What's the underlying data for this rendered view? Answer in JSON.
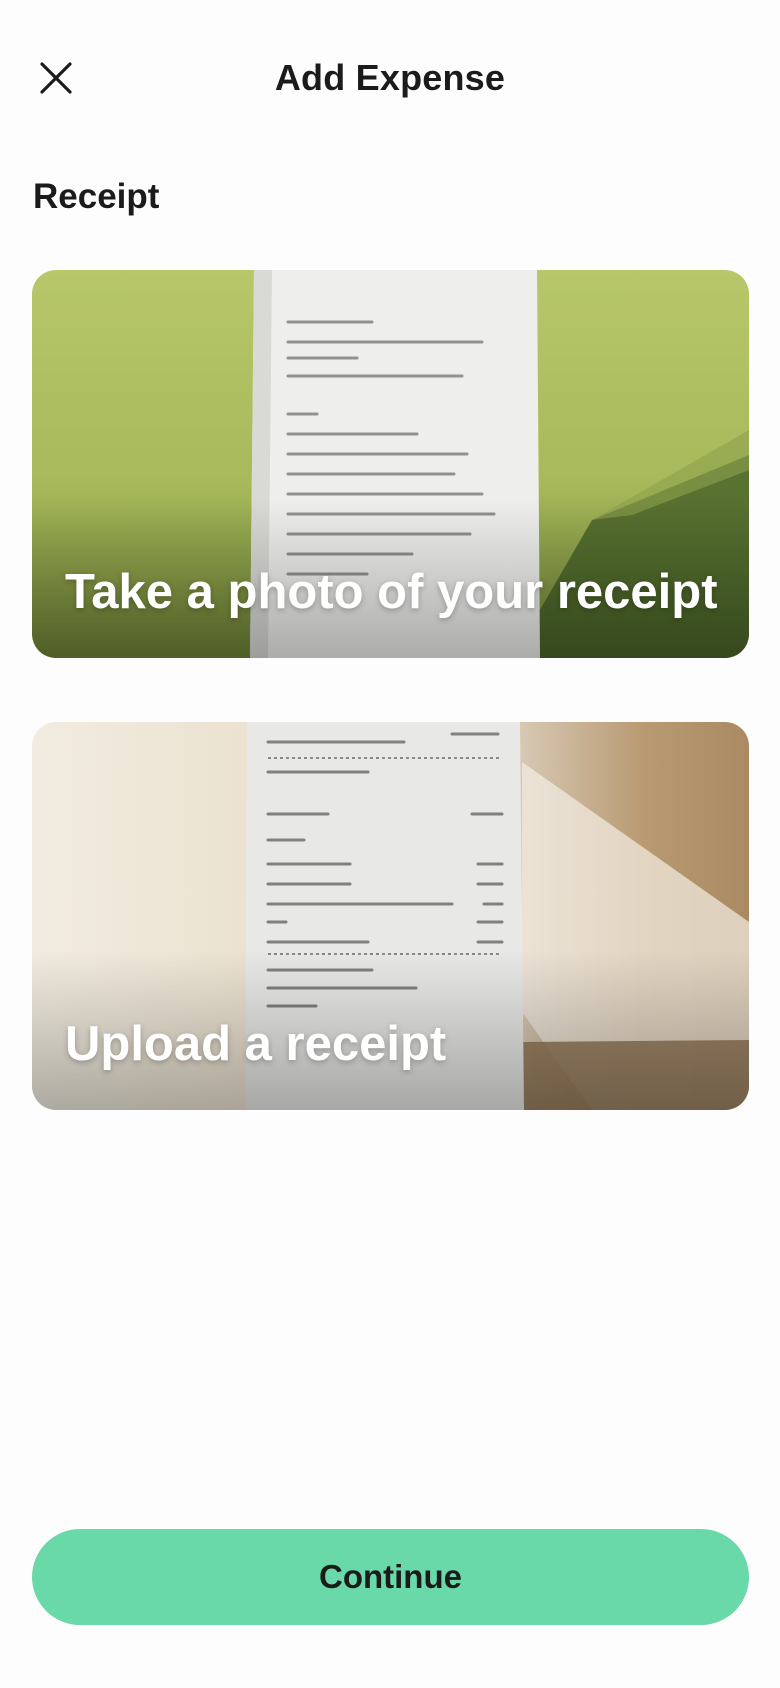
{
  "header": {
    "title": "Add Expense",
    "close_icon": "close-icon"
  },
  "receipt_section": {
    "label": "Receipt",
    "options": [
      {
        "label": "Take a photo of your receipt",
        "image": "receipt-photo-green-background"
      },
      {
        "label": "Upload a receipt",
        "image": "receipt-photo-beige-background"
      }
    ]
  },
  "footer": {
    "continue_label": "Continue"
  },
  "colors": {
    "accent": "#6ad9aa",
    "text": "#1b1b1b",
    "background": "#fdfdfd"
  }
}
